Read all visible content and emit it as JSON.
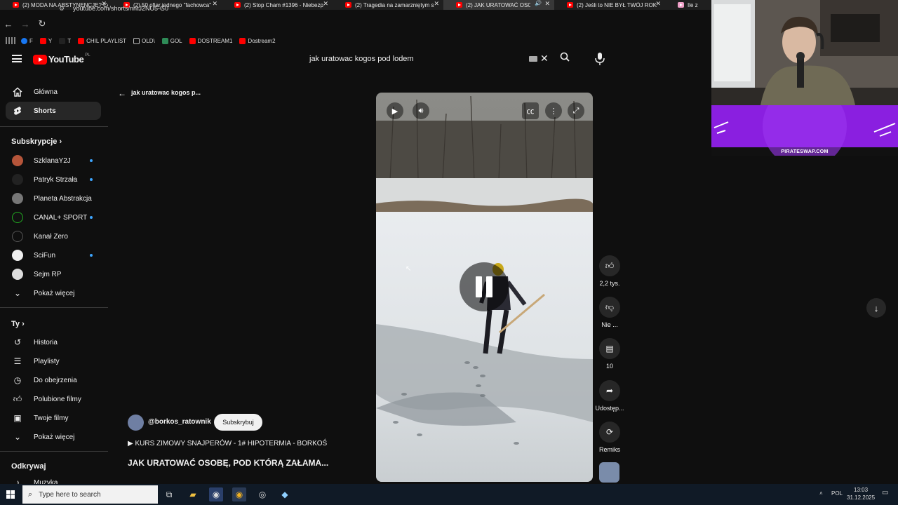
{
  "browser": {
    "tabs": [
      {
        "title": "(2) MODA NA ABSTYNENCJĘ? Co",
        "active": false
      },
      {
        "title": "(2) 50 ofiar jednego \"fachowca\"",
        "active": false
      },
      {
        "title": "(2) Stop Cham #1396 - Niebezp",
        "active": false
      },
      {
        "title": "(2) Tragedia na zamarzniętym s",
        "active": false
      },
      {
        "title": "(2) JAK URATOWAĆ OSOBĘ",
        "active": true
      },
      {
        "title": "(2) Jeśli to NIE BYŁ TWÓJ ROK",
        "active": false
      },
      {
        "title": "Ile z",
        "active": false
      }
    ],
    "close_glyph": "✕",
    "url": "youtube.com/shorts/nntJ2NU5-G0",
    "bookmarks": [
      {
        "label": "F",
        "color": "#1877f2"
      },
      {
        "label": "Y",
        "color": "#ff0000"
      },
      {
        "label": "T",
        "color": "#222222"
      },
      {
        "label": "CHIL PLAYLIST",
        "color": "#ff0000"
      },
      {
        "label": "OLD\\",
        "color": "#888888"
      },
      {
        "label": "GOL",
        "color": "#2e8b57"
      },
      {
        "label": "DOSTREAM1",
        "color": "#ff0000"
      },
      {
        "label": "Dostream2",
        "color": "#ff0000"
      }
    ]
  },
  "youtube": {
    "logo_text": "YouTube",
    "logo_country": "PL",
    "search_value": "jak uratowac kogos pod lodem",
    "sidebar": {
      "main": [
        {
          "label": "Główna",
          "icon": "home-icon",
          "active": false
        },
        {
          "label": "Shorts",
          "icon": "shorts-icon",
          "active": true
        }
      ],
      "subs_heading": "Subskrypcje",
      "subscriptions": [
        {
          "label": "SzklanaY2J",
          "color": "#b5553a",
          "dot": true
        },
        {
          "label": "Patryk Strzała",
          "color": "#222222",
          "dot": true
        },
        {
          "label": "Planeta Abstrakcja",
          "color": "#777777",
          "dot": false
        },
        {
          "label": "CANAL+ SPORT",
          "color": "#111111",
          "dot": true
        },
        {
          "label": "Kanał Zero",
          "color": "#0f0f0f",
          "dot": false
        },
        {
          "label": "SciFun",
          "color": "#eeeeee",
          "dot": true
        },
        {
          "label": "Sejm RP",
          "color": "#dddddd",
          "dot": false
        }
      ],
      "subs_more": "Pokaż więcej",
      "you_heading": "Ty",
      "you_items": [
        {
          "label": "Historia",
          "icon": "history-icon"
        },
        {
          "label": "Playlisty",
          "icon": "playlist-icon"
        },
        {
          "label": "Do obejrzenia",
          "icon": "watch-later-icon"
        },
        {
          "label": "Polubione filmy",
          "icon": "like-icon"
        },
        {
          "label": "Twoje filmy",
          "icon": "your-videos-icon"
        }
      ],
      "you_more": "Pokaż więcej",
      "explore_heading": "Odkrywaj",
      "explore_items": [
        {
          "label": "Muzyka",
          "icon": "music-icon"
        }
      ]
    },
    "back_title": "jak uratowac kogos p...",
    "actions": [
      {
        "name": "like",
        "icon": "thumb-up-icon",
        "label": "2,2 tys."
      },
      {
        "name": "dislike",
        "icon": "thumb-down-icon",
        "label": "Nie ..."
      },
      {
        "name": "comments",
        "icon": "comment-icon",
        "label": "10"
      },
      {
        "name": "share",
        "icon": "share-icon",
        "label": "Udostęp..."
      },
      {
        "name": "remix",
        "icon": "remix-icon",
        "label": "Remiks"
      }
    ],
    "channel_handle": "@borkos_ratownik",
    "subscribe_label": "Subskrybuj",
    "track_label": "KURS ZIMOWY SNAJPERÓW - 1# HIPOTERMIA - BORKOŚ",
    "video_title": "JAK URATOWAĆ OSOBĘ, POD KTÓRĄ ZAŁAMA..."
  },
  "overlay": {
    "brand": "PIRATESWAP.COM"
  },
  "taskbar": {
    "search_placeholder": "Type here to search",
    "language": "POL",
    "time": "13:03",
    "date": "31.12.2025"
  }
}
